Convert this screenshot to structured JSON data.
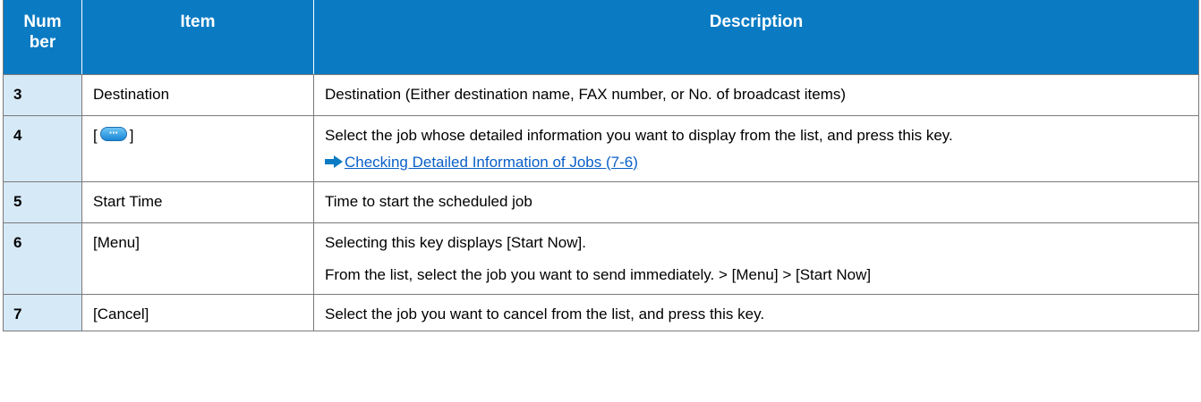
{
  "table": {
    "headers": {
      "number": "Num ber",
      "item": "Item",
      "description": "Description"
    },
    "rows": [
      {
        "number": "3",
        "item": "Destination",
        "description": [
          "Destination (Either destination name, FAX number, or No. of broadcast items)"
        ]
      },
      {
        "number": "4",
        "item_prefix": "[",
        "item_icon": "ellipsis-key-icon",
        "item_suffix": "]",
        "description": [
          "Select the job whose detailed information you want to display from the list, and press this key."
        ],
        "link": {
          "icon": "arrow-right-icon",
          "text": "Checking Detailed Information of Jobs (7-6)"
        }
      },
      {
        "number": "5",
        "item": "Start Time",
        "description": [
          "Time to start the scheduled job"
        ]
      },
      {
        "number": "6",
        "item": "[Menu]",
        "description": [
          "Selecting this key displays [Start Now].",
          "From the list, select the job you want to send immediately. > [Menu] > [Start Now]"
        ]
      },
      {
        "number": "7",
        "item": "[Cancel]",
        "description": [
          "Select the job you want to cancel from the list, and press this key."
        ]
      }
    ]
  },
  "colors": {
    "header_bg": "#0a7bc3",
    "number_cell_bg": "#d6e9f7",
    "link": "#0a5fc8"
  }
}
